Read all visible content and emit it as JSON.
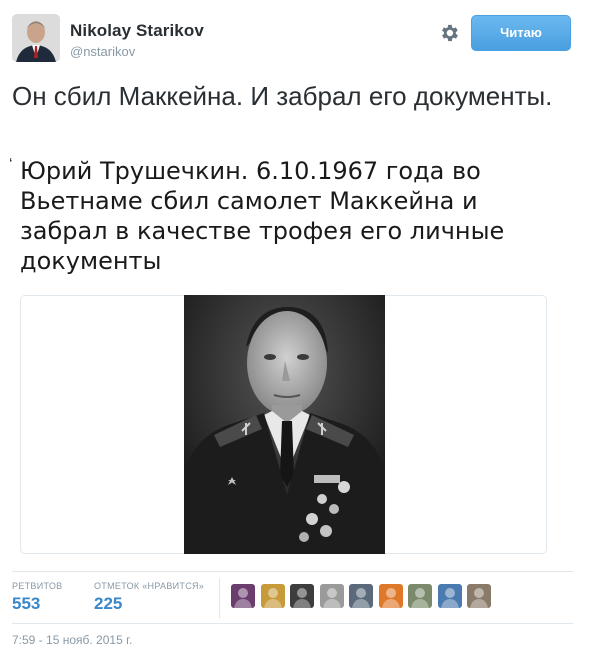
{
  "user": {
    "display_name": "Nikolay Starikov",
    "screen_name": "@nstarikov",
    "avatar_icon": "person-avatar-icon"
  },
  "actions": {
    "gear_icon": "gear-icon",
    "follow_label": "Читаю"
  },
  "tweet": {
    "text": "Он сбил Маккейна. И забрал его документы.",
    "image_caption": "Юрий Трушечкин. 6.10.1967 года во Вьетнаме сбил самолет Маккейна и забрал в качестве трофея его личные документы",
    "caption_mark": "‘"
  },
  "stats": {
    "retweets_label": "РЕТВИТОВ",
    "retweets_value": "553",
    "likes_label": "ОТМЕТОК «НРАВИТСЯ»",
    "likes_value": "225"
  },
  "likers": [
    {
      "icon": "liker-avatar-icon",
      "color": "#6a3d6e"
    },
    {
      "icon": "liker-avatar-icon",
      "color": "#c79a3a"
    },
    {
      "icon": "liker-avatar-icon",
      "color": "#3d3d3d"
    },
    {
      "icon": "liker-avatar-icon",
      "color": "#9a9a9a"
    },
    {
      "icon": "liker-avatar-icon",
      "color": "#5a6a7a"
    },
    {
      "icon": "liker-avatar-icon",
      "color": "#e0782a"
    },
    {
      "icon": "liker-avatar-icon",
      "color": "#7a8a6a"
    },
    {
      "icon": "liker-avatar-icon",
      "color": "#4a7ab0"
    },
    {
      "icon": "liker-avatar-icon",
      "color": "#8a7a6a"
    }
  ],
  "timestamp": "7:59 - 15 нояб. 2015 г.",
  "colors": {
    "accent": "#3a87c9",
    "follow_button": "#55acee",
    "muted_text": "#8899a6"
  }
}
